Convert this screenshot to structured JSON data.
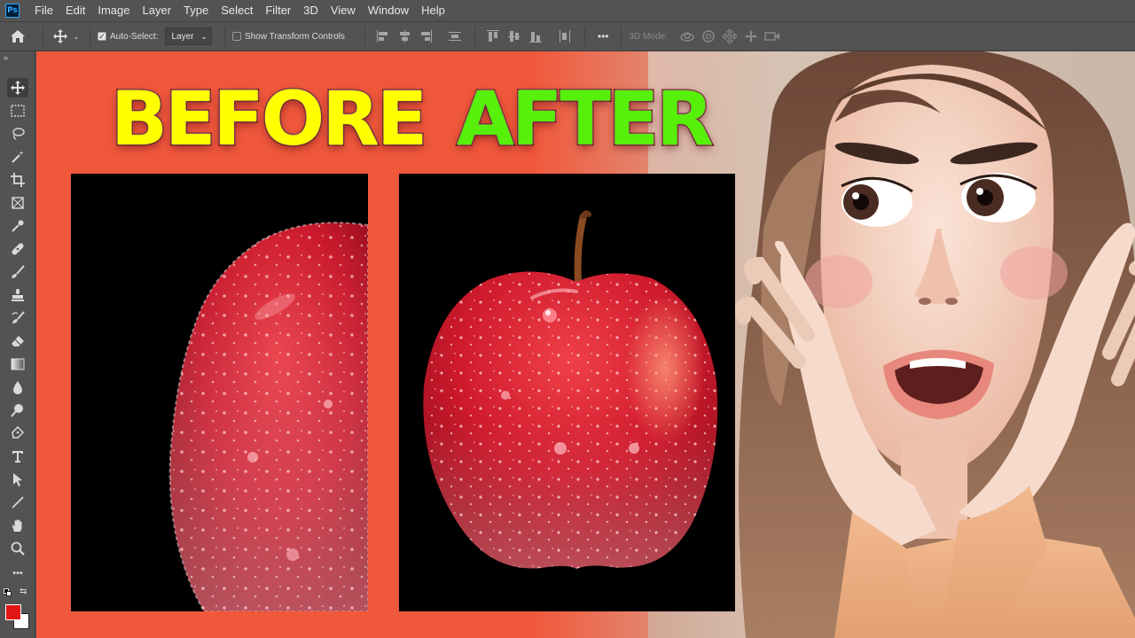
{
  "app": {
    "logo": "Ps",
    "menu": [
      "File",
      "Edit",
      "Image",
      "Layer",
      "Type",
      "Select",
      "Filter",
      "3D",
      "View",
      "Window",
      "Help"
    ]
  },
  "options": {
    "auto_select_label": "Auto-Select:",
    "auto_select_value": "Layer",
    "show_transform_label": "Show Transform Controls",
    "three_d_mode_label": "3D Mode:",
    "more_label": "•••"
  },
  "tools": {
    "collapse_label": "»",
    "more_label": "•••",
    "foreground_color": "#e21515",
    "background_color": "#ffffff"
  },
  "canvas": {
    "before_label": "BEFORE",
    "after_label": "AFTER",
    "background_color": "#f0583c",
    "before_color": "#ffff00",
    "after_color": "#56f00a"
  }
}
